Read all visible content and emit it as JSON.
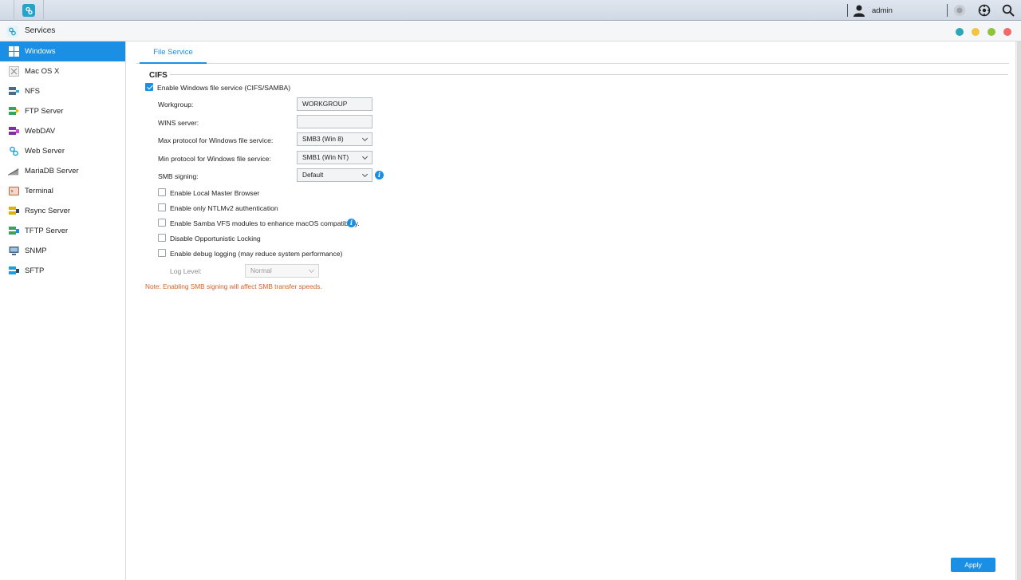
{
  "topbar": {
    "username": "admin",
    "icons": [
      "app-icon",
      "user-icon",
      "notification-icon",
      "options-icon",
      "search-icon"
    ]
  },
  "window": {
    "title": "Services",
    "controls": [
      {
        "name": "info-dot",
        "color": "#2aa8b6"
      },
      {
        "name": "minimize-dot",
        "color": "#f2c540"
      },
      {
        "name": "maximize-dot",
        "color": "#8fc43a"
      },
      {
        "name": "close-dot",
        "color": "#ef6a6a"
      }
    ]
  },
  "sidebar": {
    "items": [
      {
        "label": "Windows",
        "icon": "windows-icon",
        "active": true
      },
      {
        "label": "Mac OS X",
        "icon": "macos-icon"
      },
      {
        "label": "NFS",
        "icon": "nfs-icon"
      },
      {
        "label": "FTP Server",
        "icon": "ftp-icon"
      },
      {
        "label": "WebDAV",
        "icon": "webdav-icon"
      },
      {
        "label": "Web Server",
        "icon": "web-server-icon"
      },
      {
        "label": "MariaDB Server",
        "icon": "mariadb-icon"
      },
      {
        "label": "Terminal",
        "icon": "terminal-icon"
      },
      {
        "label": "Rsync Server",
        "icon": "rsync-icon"
      },
      {
        "label": "TFTP Server",
        "icon": "tftp-icon"
      },
      {
        "label": "SNMP",
        "icon": "snmp-icon"
      },
      {
        "label": "SFTP",
        "icon": "sftp-icon"
      }
    ]
  },
  "main": {
    "tab": "File Service",
    "section": "CIFS",
    "enable_label": "Enable Windows file service (CIFS/SAMBA)",
    "enable_checked": true,
    "workgroup_label": "Workgroup:",
    "workgroup_value": "WORKGROUP",
    "wins_label": "WINS server:",
    "wins_value": "",
    "max_protocol_label": "Max protocol for Windows file service:",
    "max_protocol_value": "SMB3 (Win 8)",
    "min_protocol_label": "Min protocol for Windows file service:",
    "min_protocol_value": "SMB1 (Win NT)",
    "smb_signing_label": "SMB signing:",
    "smb_signing_value": "Default",
    "options": [
      {
        "label": "Enable Local Master Browser",
        "checked": false
      },
      {
        "label": "Enable only NTLMv2 authentication",
        "checked": false
      },
      {
        "label": "Enable Samba VFS modules to enhance macOS compatibility.",
        "checked": false
      },
      {
        "label": "Disable Opportunistic Locking",
        "checked": false
      },
      {
        "label": "Enable debug logging (may reduce system performance)",
        "checked": false
      }
    ],
    "log_level_label": "Log Level:",
    "log_level_value": "Normal",
    "note": "Note: Enabling SMB signing will affect SMB transfer speeds.",
    "apply_label": "Apply"
  }
}
